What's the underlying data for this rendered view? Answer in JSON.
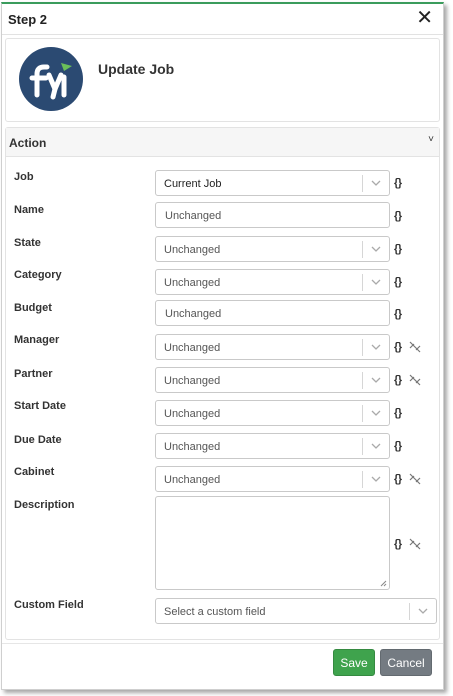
{
  "dialog": {
    "title": "Step 2",
    "close_glyph": "✕",
    "accent_color": "#3a9c5c"
  },
  "header": {
    "logo_text": "fyi",
    "logo_color": "#2b4a72",
    "title": "Update Job"
  },
  "action": {
    "label": "Action",
    "chevron_glyph": "˅"
  },
  "fields": {
    "job": {
      "label": "Job",
      "value": "Current Job",
      "token": "{}"
    },
    "name": {
      "label": "Name",
      "value": "Unchanged",
      "token": "{}"
    },
    "state": {
      "label": "State",
      "value": "Unchanged",
      "token": "{}"
    },
    "category": {
      "label": "Category",
      "value": "Unchanged",
      "token": "{}"
    },
    "budget": {
      "label": "Budget",
      "value": "Unchanged",
      "token": "{}"
    },
    "manager": {
      "label": "Manager",
      "value": "Unchanged",
      "token": "{}"
    },
    "partner": {
      "label": "Partner",
      "value": "Unchanged",
      "token": "{}"
    },
    "start_date": {
      "label": "Start Date",
      "value": "Unchanged",
      "token": "{}"
    },
    "due_date": {
      "label": "Due Date",
      "value": "Unchanged",
      "token": "{}"
    },
    "cabinet": {
      "label": "Cabinet",
      "value": "Unchanged",
      "token": "{}"
    },
    "description": {
      "label": "Description",
      "value": "",
      "token": "{}"
    },
    "custom_field": {
      "label": "Custom Field",
      "placeholder": "Select a custom field"
    }
  },
  "buttons": {
    "save": "Save",
    "cancel": "Cancel",
    "save_color": "#3fa34d",
    "cancel_color": "#747b82"
  }
}
